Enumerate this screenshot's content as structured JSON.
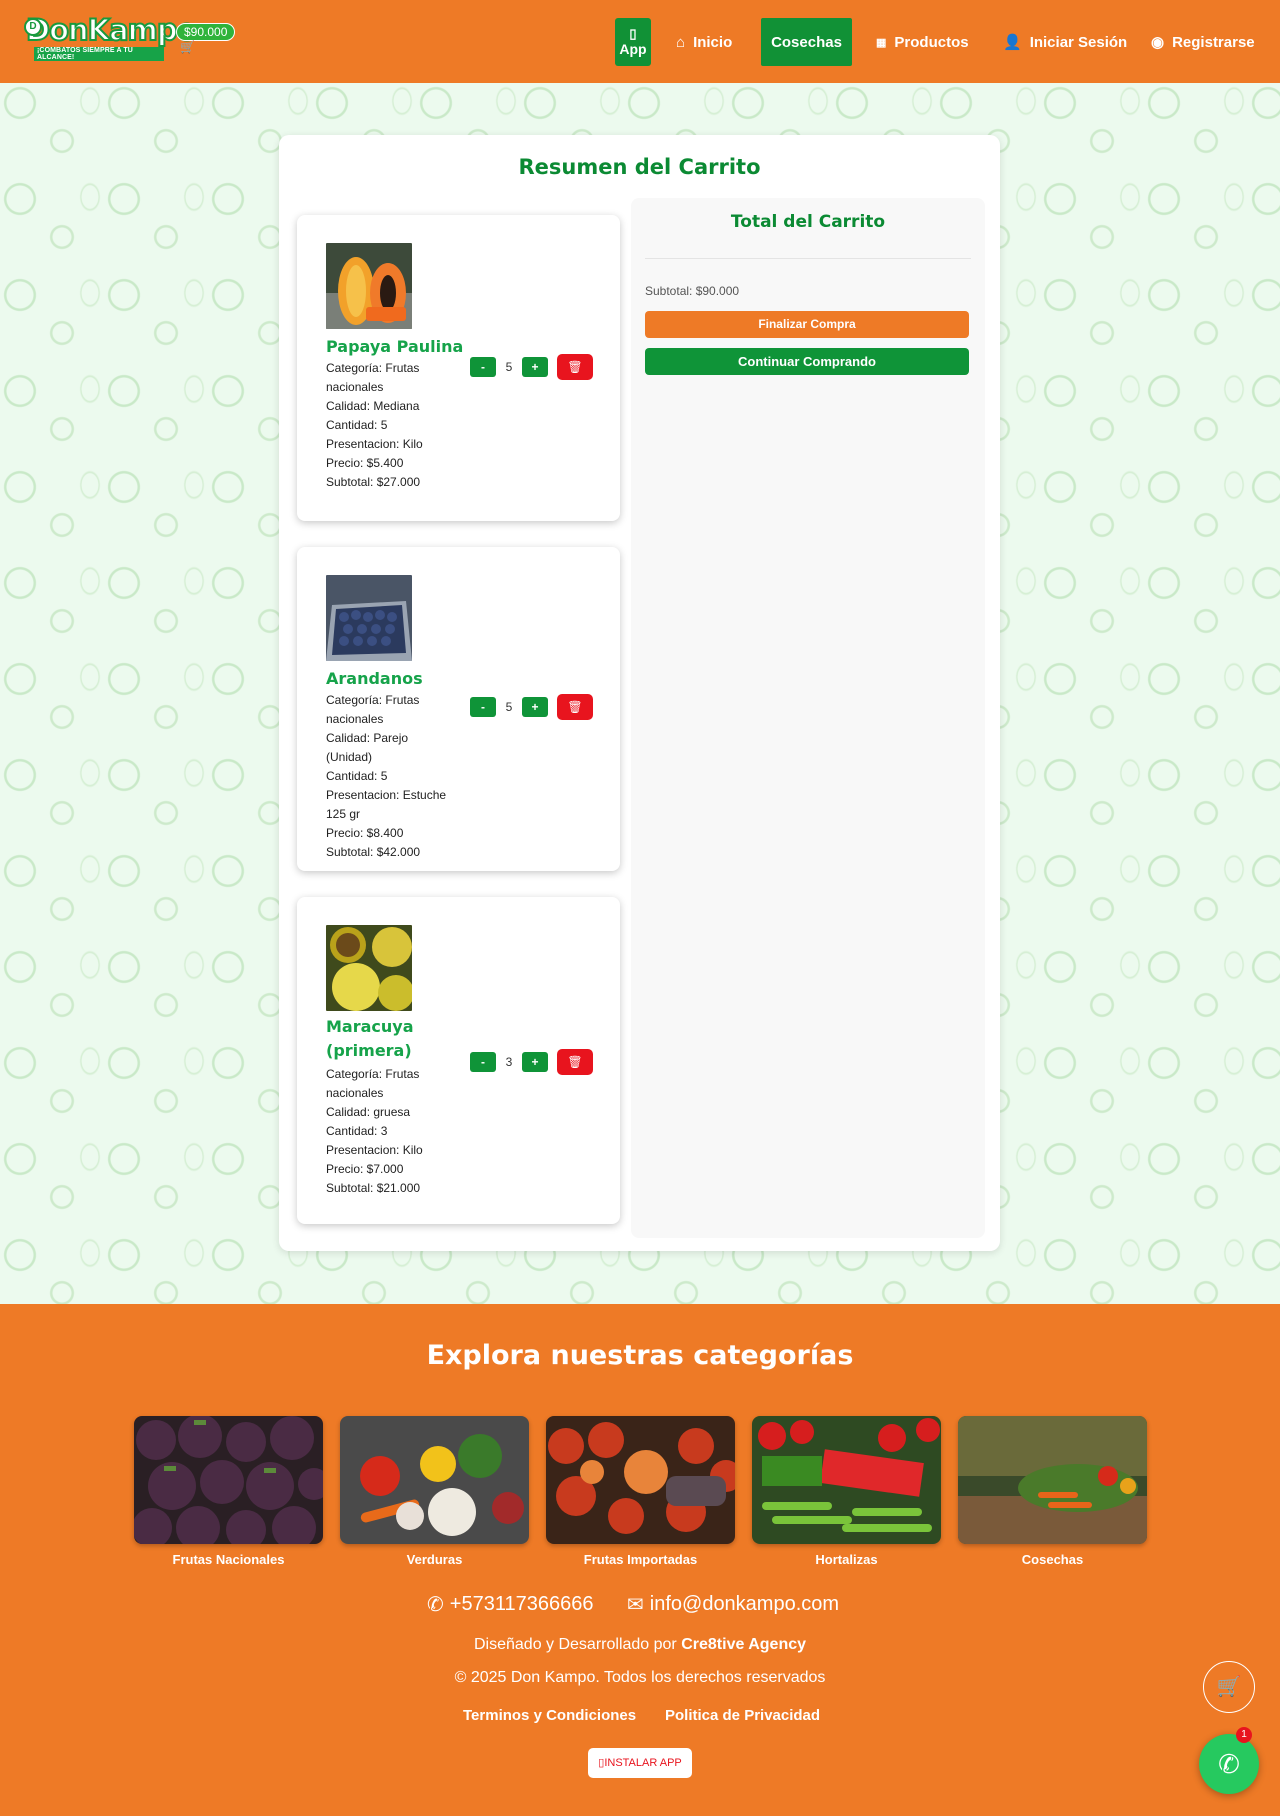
{
  "header": {
    "logo_text": "DonKampo",
    "logo_tagline": "¡COMBATOS SIEMPRE A TU ALCANCE!",
    "cart_total": "$90.000",
    "nav": {
      "app": "App",
      "inicio": "Inicio",
      "cosechas": "Cosechas",
      "productos": "Productos",
      "login": "Iniciar Sesión",
      "register": "Registrarse"
    }
  },
  "cart": {
    "title": "Resumen del Carrito",
    "items": [
      {
        "name": "Papaya Paulina",
        "category": "Categoría: Frutas nacionales",
        "quality": "Calidad: Mediana",
        "quantity_text": "Cantidad: 5",
        "presentation": "Presentacion: Kilo",
        "price": "Precio: $5.400",
        "subtotal": "Subtotal: $27.000",
        "qty": "5",
        "image": "papaya"
      },
      {
        "name": "Arandanos",
        "category": "Categoría: Frutas nacionales",
        "quality": "Calidad: Parejo (Unidad)",
        "quantity_text": "Cantidad: 5",
        "presentation": "Presentacion: Estuche 125 gr",
        "price": "Precio: $8.400",
        "subtotal": "Subtotal: $42.000",
        "qty": "5",
        "image": "blueberries"
      },
      {
        "name": "Maracuya (primera)",
        "category": "Categoría: Frutas nacionales",
        "quality": "Calidad: gruesa",
        "quantity_text": "Cantidad: 3",
        "presentation": "Presentacion: Kilo",
        "price": "Precio: $7.000",
        "subtotal": "Subtotal: $21.000",
        "qty": "3",
        "image": "passion-fruit"
      }
    ],
    "minus_label": "-",
    "plus_label": "+",
    "summary": {
      "title": "Total del Carrito",
      "subtotal": "Subtotal: $90.000",
      "checkout": "Finalizar Compra",
      "continue": "Continuar Comprando"
    }
  },
  "footer": {
    "title": "Explora nuestras categorías",
    "categories": [
      "Frutas Nacionales",
      "Verduras",
      "Frutas Importadas",
      "Hortalizas",
      "Cosechas"
    ],
    "phone": "+573117366666",
    "email": "info@donkampo.com",
    "credit_prefix": "Diseñado y Desarrollado por",
    "credit_agency": "Cre8tive Agency",
    "copyright": "© 2025 Don Kampo. Todos los derechos reservados",
    "terms": "Terminos y Condiciones",
    "privacy": "Politica de Privacidad",
    "install": "INSTALAR APP",
    "whatsapp_badge": "1"
  },
  "colors": {
    "brand_orange": "#ee7a26",
    "brand_green": "#0f9438",
    "delete_red": "#e8141e"
  }
}
